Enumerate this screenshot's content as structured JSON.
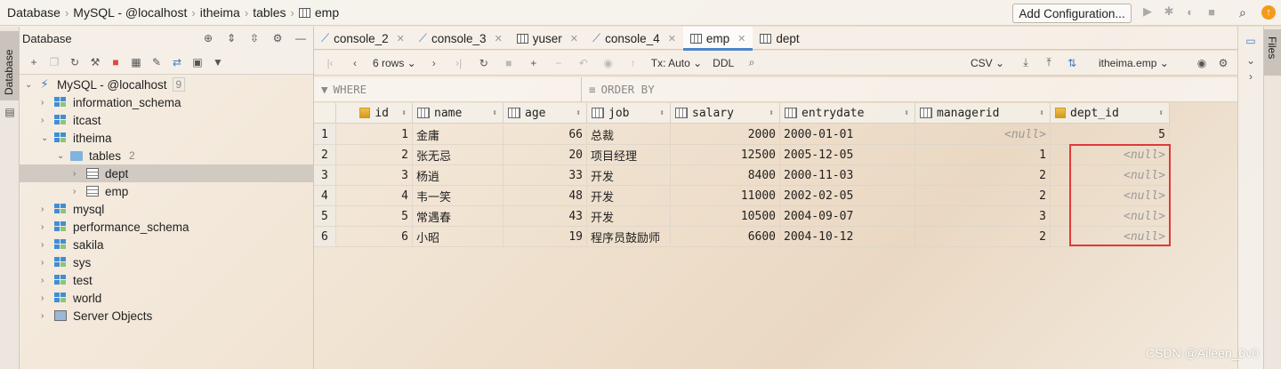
{
  "breadcrumb": [
    "Database",
    "MySQL - @localhost",
    "itheima",
    "tables",
    "emp"
  ],
  "top": {
    "add_config": "Add Configuration..."
  },
  "left_strip": {
    "label": "Database"
  },
  "db_panel": {
    "title": "Database",
    "tree": [
      {
        "label": "MySQL - @localhost",
        "count": "9",
        "level": 0,
        "expanded": true,
        "kind": "server"
      },
      {
        "label": "information_schema",
        "level": 1,
        "kind": "schema"
      },
      {
        "label": "itcast",
        "level": 1,
        "kind": "schema"
      },
      {
        "label": "itheima",
        "level": 1,
        "expanded": true,
        "kind": "schema"
      },
      {
        "label": "tables",
        "count": "2",
        "level": 2,
        "expanded": true,
        "kind": "folder"
      },
      {
        "label": "dept",
        "level": 3,
        "kind": "table",
        "selected": true
      },
      {
        "label": "emp",
        "level": 3,
        "kind": "table"
      },
      {
        "label": "mysql",
        "level": 1,
        "kind": "schema"
      },
      {
        "label": "performance_schema",
        "level": 1,
        "kind": "schema"
      },
      {
        "label": "sakila",
        "level": 1,
        "kind": "schema"
      },
      {
        "label": "sys",
        "level": 1,
        "kind": "schema"
      },
      {
        "label": "test",
        "level": 1,
        "kind": "schema"
      },
      {
        "label": "world",
        "level": 1,
        "kind": "schema"
      },
      {
        "label": "Server Objects",
        "level": 1,
        "kind": "objects"
      }
    ]
  },
  "tabs": [
    {
      "label": "console_2",
      "kind": "console"
    },
    {
      "label": "console_3",
      "kind": "console"
    },
    {
      "label": "yuser",
      "kind": "table"
    },
    {
      "label": "console_4",
      "kind": "console"
    },
    {
      "label": "emp",
      "kind": "table",
      "active": true
    },
    {
      "label": "dept",
      "kind": "table"
    }
  ],
  "grid_toolbar": {
    "rows": "6 rows",
    "tx": "Tx: Auto",
    "ddl": "DDL",
    "export": "CSV",
    "datasource": "itheima.emp"
  },
  "filter": {
    "where": "WHERE",
    "order_by": "ORDER BY"
  },
  "columns": [
    "id",
    "name",
    "age",
    "job",
    "salary",
    "entrydate",
    "managerid",
    "dept_id"
  ],
  "rows": [
    [
      "1",
      "1",
      "金庸",
      "66",
      "总裁",
      "2000",
      "2000-01-01",
      "<null>",
      "5"
    ],
    [
      "2",
      "2",
      "张无忌",
      "20",
      "项目经理",
      "12500",
      "2005-12-05",
      "1",
      "<null>"
    ],
    [
      "3",
      "3",
      "杨逍",
      "33",
      "开发",
      "8400",
      "2000-11-03",
      "2",
      "<null>"
    ],
    [
      "4",
      "4",
      "韦一笑",
      "48",
      "开发",
      "11000",
      "2002-02-05",
      "2",
      "<null>"
    ],
    [
      "5",
      "5",
      "常遇春",
      "43",
      "开发",
      "10500",
      "2004-09-07",
      "3",
      "<null>"
    ],
    [
      "6",
      "6",
      "小昭",
      "19",
      "程序员鼓励师",
      "6600",
      "2004-10-12",
      "2",
      "<null>"
    ]
  ],
  "files_strip": {
    "label": "Files"
  },
  "watermark": "CSDN @Aileen_0v0"
}
